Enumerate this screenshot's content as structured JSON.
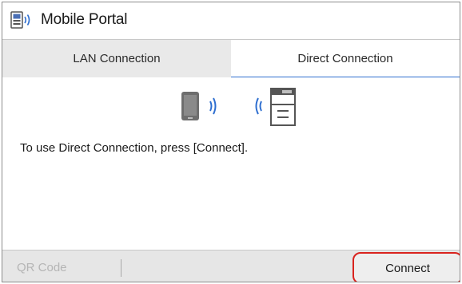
{
  "app": {
    "title": "Mobile Portal",
    "title_icon": "mobile-portal-icon"
  },
  "tabs": [
    {
      "label": "LAN Connection",
      "selected": false
    },
    {
      "label": "Direct Connection",
      "selected": true
    }
  ],
  "main": {
    "illustration": {
      "left_icon": "smartphone-icon",
      "right_icon": "printer-icon",
      "signal_icon": "wireless-signal-icon"
    },
    "message": "To use Direct Connection, press [Connect]."
  },
  "footer": {
    "qr_label": "QR Code",
    "qr_enabled": false,
    "connect_label": "Connect"
  },
  "colors": {
    "tab_underline": "#2f6fd0",
    "highlight": "#d9231e",
    "disabled_text": "#b5b5b5"
  }
}
